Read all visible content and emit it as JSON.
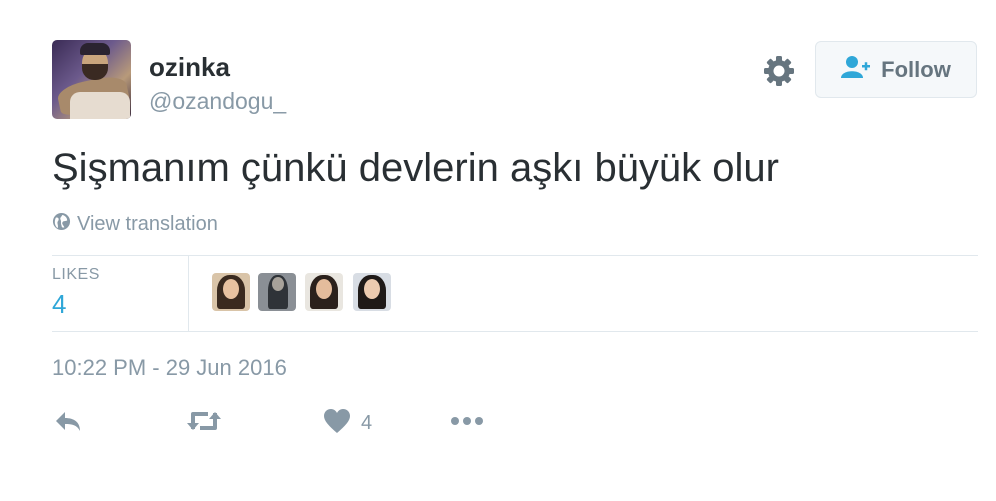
{
  "user": {
    "display_name": "ozinka",
    "screen_name": "@ozandogu_",
    "avatar_icon": "user-avatar-photo"
  },
  "header": {
    "settings_icon": "gear-icon",
    "follow_label": "Follow",
    "follow_icon": "add-user-icon"
  },
  "tweet": {
    "text": "Şişmanım çünkü devlerin aşkı büyük olur",
    "translate_label": "View translation",
    "translate_icon": "globe-icon"
  },
  "stats": {
    "likes_label": "LIKES",
    "likes_count": "4",
    "likers": [
      {
        "avatar": "liker-avatar-1"
      },
      {
        "avatar": "liker-avatar-2"
      },
      {
        "avatar": "liker-avatar-3"
      },
      {
        "avatar": "liker-avatar-4"
      }
    ]
  },
  "timestamp": "10:22 PM - 29 Jun 2016",
  "actions": {
    "reply_icon": "reply-icon",
    "retweet_icon": "retweet-icon",
    "like_icon": "heart-icon",
    "like_count": "4",
    "more_icon": "more-icon"
  },
  "colors": {
    "text": "#292f33",
    "muted": "#8899a6",
    "accent": "#2fa7d8",
    "button_bg": "#f5f8fa",
    "border": "#e1e8ed"
  }
}
